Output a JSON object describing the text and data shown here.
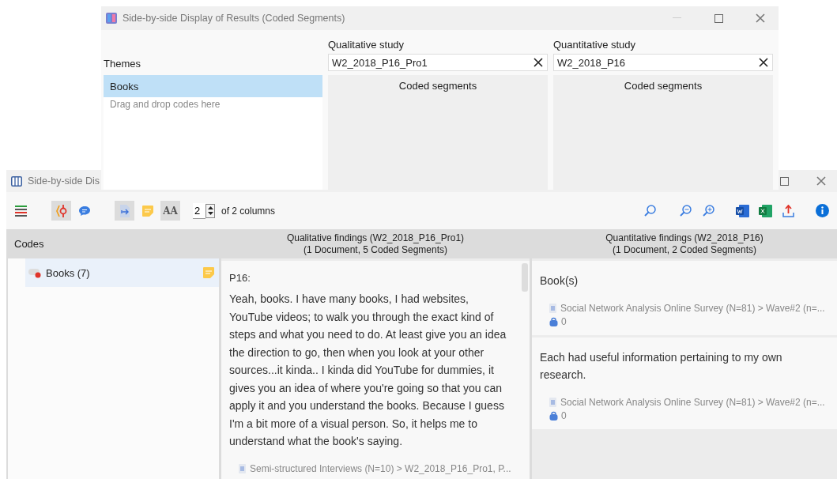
{
  "dialog": {
    "title": "Side-by-side Display of Results (Coded Segments)",
    "themes_label": "Themes",
    "themes": [
      {
        "label": "Books",
        "selected": true
      }
    ],
    "drop_hint": "Drag and drop codes here",
    "studies": [
      {
        "label": "Qualitative study",
        "value": "W2_2018_P16_Pro1",
        "panel_title": "Coded segments"
      },
      {
        "label": "Quantitative study",
        "value": "W2_2018_P16",
        "panel_title": "Coded segments"
      }
    ]
  },
  "results": {
    "title": "Side-by-side Dis",
    "toolbar": [
      {
        "kind": "code-colors",
        "pressed": false
      },
      {
        "kind": "code-link",
        "pressed": true
      },
      {
        "kind": "comment",
        "pressed": false
      },
      {
        "kind": "export-doc",
        "pressed": true
      },
      {
        "kind": "memo",
        "pressed": false
      },
      {
        "kind": "font-size",
        "pressed": true,
        "label": "AA"
      }
    ],
    "columns_value": "2",
    "columns_text": "of 2 columns",
    "codes_header": "Codes",
    "codes": [
      {
        "label": "Books (7)",
        "selected": true,
        "color": "#e0342a"
      }
    ],
    "columns": [
      {
        "title": "Qualitative findings (W2_2018_P16_Pro1)",
        "subtitle": "(1 Document, 5 Coded Segments)",
        "segments": [
          {
            "heading": "P16:",
            "text": "Yeah, books. I have many books, I had websites, YouTube videos; to walk you through the exact kind of steps and what you need to do. At least give you an idea the direction to go, then when you look at your other sources...it kinda.. I kinda did YouTube for dummies, it gives you an idea of where you're going so that you can apply it and you understand the books. Because I guess I'm a bit more of a visual person. So, it helps me to understand what the book's saying.",
            "source": "Semi-structured Interviews (N=10) > W2_2018_P16_Pro1, P..."
          }
        ]
      },
      {
        "title": "Quantitative findings (W2_2018_P16)",
        "subtitle": "(1 Document, 2 Coded Segments)",
        "segments": [
          {
            "text": "Book(s)",
            "source": "Social Network Analysis Online Survey (N=81) > Wave#2 (n=...",
            "weight": "0"
          },
          {
            "text": "Each had useful information pertaining to my own research.",
            "source": "Social Network Analysis Online Survey (N=81) > Wave#2 (n=...",
            "weight": "0"
          }
        ]
      }
    ]
  }
}
